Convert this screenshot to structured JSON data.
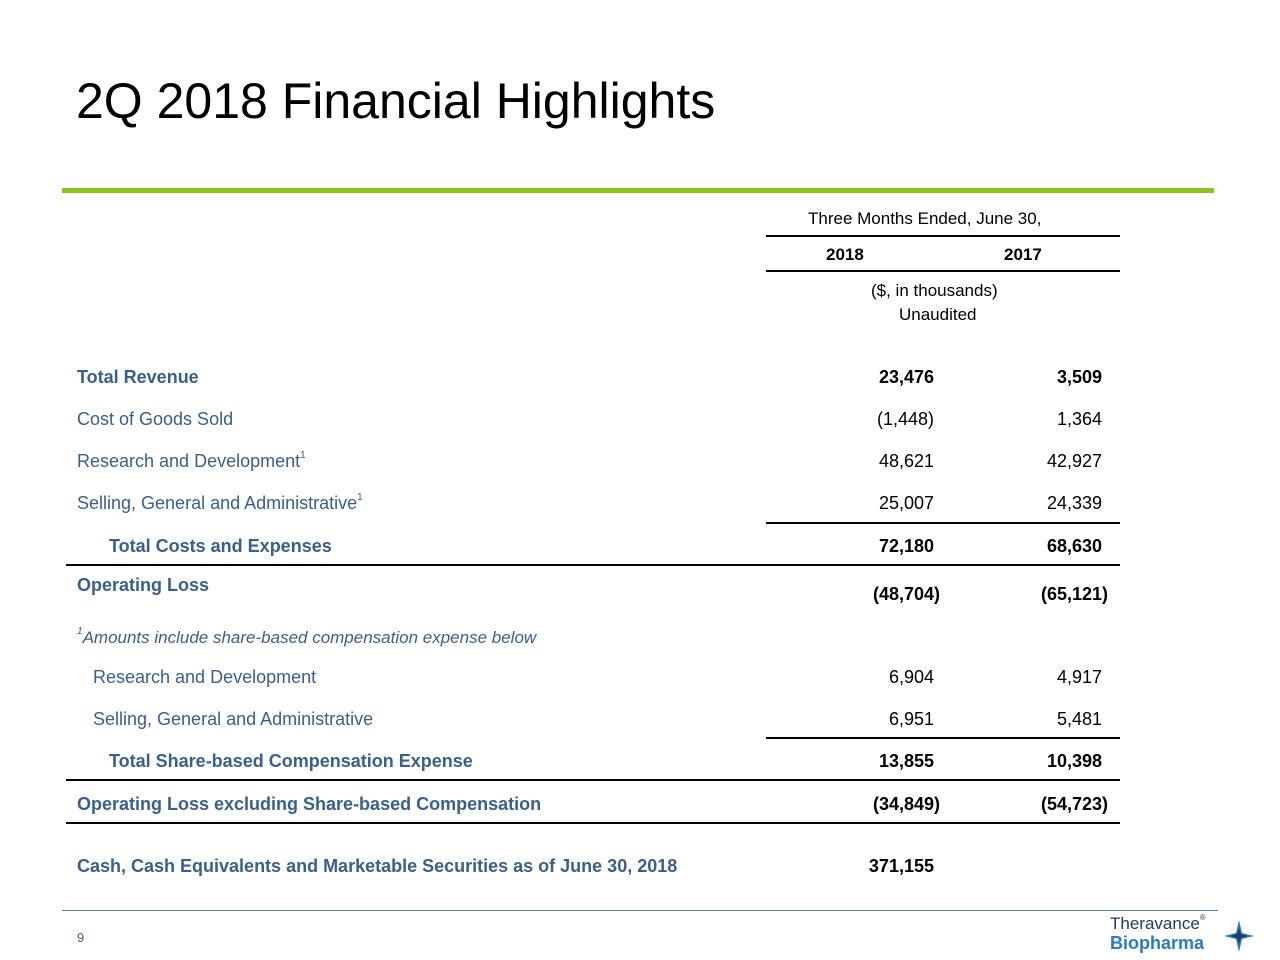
{
  "title": "2Q 2018 Financial Highlights",
  "header": {
    "period": "Three Months Ended, June 30,",
    "col1": "2018",
    "col2": "2017",
    "units": "($, in thousands)",
    "audit": "Unaudited"
  },
  "rows": {
    "total_revenue": {
      "label": "Total Revenue",
      "v2018": "23,476",
      "v2017": "3,509"
    },
    "cogs": {
      "label": "Cost of Goods Sold",
      "v2018": "(1,448)",
      "v2017": "1,364"
    },
    "rnd": {
      "label": "Research and Development",
      "sup": "1",
      "v2018": "48,621",
      "v2017": "42,927"
    },
    "sga": {
      "label": "Selling, General and Administrative",
      "sup": "1",
      "v2018": "25,007",
      "v2017": "24,339"
    },
    "total_costs": {
      "label": "Total Costs and Expenses",
      "v2018": "72,180",
      "v2017": "68,630"
    },
    "operating_loss": {
      "label": "Operating Loss",
      "v2018": "(48,704)",
      "v2017": "(65,121)"
    }
  },
  "footnote": {
    "sup": "1",
    "text": "Amounts include share-based compensation expense below"
  },
  "sbc": {
    "rnd": {
      "label": "Research and Development",
      "v2018": "6,904",
      "v2017": "4,917"
    },
    "sga": {
      "label": "Selling, General and Administrative",
      "v2018": "6,951",
      "v2017": "5,481"
    },
    "total": {
      "label": "Total Share-based Compensation Expense",
      "v2018": "13,855",
      "v2017": "10,398"
    }
  },
  "op_loss_ex_sbc": {
    "label": "Operating Loss excluding Share-based Compensation",
    "v2018": "(34,849)",
    "v2017": "(54,723)"
  },
  "cash": {
    "label": "Cash, Cash Equivalents and Marketable Securities as of June 30, 2018",
    "v2018": "371,155"
  },
  "page_number": "9",
  "logo": {
    "line1": "Theravance",
    "reg": "®",
    "line2": "Biopharma",
    "icon": "star-logo-icon"
  },
  "colors": {
    "accent_green": "#8dc21f",
    "label_blue": "#3a5f8c",
    "logo_blue": "#2a7bc0"
  }
}
